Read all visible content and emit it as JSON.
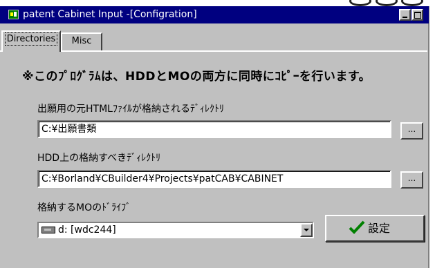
{
  "window": {
    "title": "patent Cabinet Input -[Configration]"
  },
  "tabs": [
    {
      "label": "Directories",
      "active": true
    },
    {
      "label": "Misc",
      "active": false
    }
  ],
  "main": {
    "notice": "※このﾌﾟﾛｸﾞﾗﾑは、HDDとMOの両方に同時にｺﾋﾟｰを行います。",
    "source_label": "出願用の元HTMLﾌｧｲﾙが格納されるﾃﾞｨﾚｸﾄﾘ",
    "source_value": "C:¥出願書類",
    "hdd_label": "HDD上の格納すべきﾃﾞｨﾚｸﾄﾘ",
    "hdd_value": "C:¥Borland¥CBuilder4¥Projects¥patCAB¥CABINET",
    "drive_label": "格納するMOのﾄﾞﾗｲﾌﾞ",
    "drive_value": "d: [wdc244]",
    "browse_label": "...",
    "set_label": "設定"
  },
  "colors": {
    "titlebar": "#000080",
    "face": "#c0c0c0",
    "check": "#008000"
  },
  "icons": [
    "app-icon",
    "minimize-icon",
    "maximize-icon",
    "drive-icon",
    "chevron-down-icon",
    "checkmark-icon"
  ]
}
